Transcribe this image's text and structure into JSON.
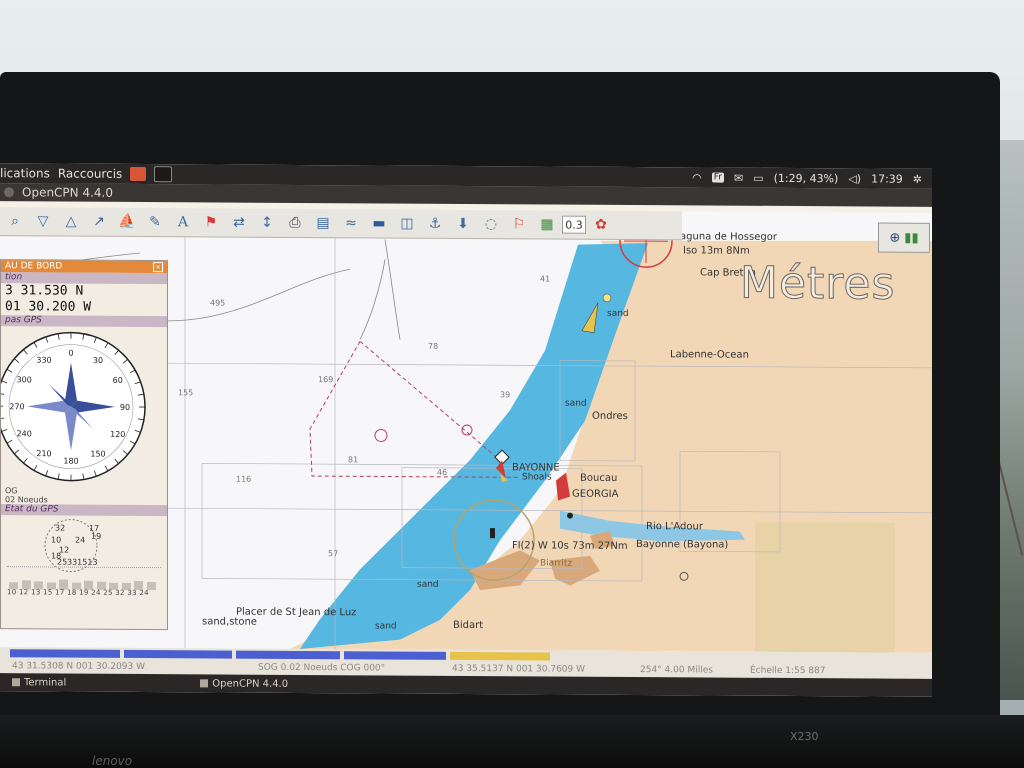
{
  "system_bar": {
    "menus": [
      "lications",
      "Raccourcis"
    ],
    "kbd_layout": "Fr",
    "battery": "(1:29, 43%)",
    "clock": "17:39"
  },
  "window": {
    "title": "OpenCPN 4.4.0"
  },
  "toolbar": {
    "scale_value": "0.3"
  },
  "overlay": {
    "units_watermark": "Métres"
  },
  "dashboard": {
    "title": "AU DE BORD",
    "section_position": "tion",
    "lat": "3 31.530 N",
    "lon": "01 30.200 W",
    "section_compass": "pas GPS",
    "compass_labels": [
      "0",
      "30",
      "60",
      "90",
      "120",
      "150",
      "180",
      "210",
      "240",
      "270",
      "300",
      "330"
    ],
    "sog_line1": "OG",
    "sog_line2": "02 Noeuds",
    "section_gps": "Etat du GPS",
    "sat_ids": [
      "32",
      "17",
      "10",
      "24",
      "19",
      "12",
      "18",
      "25",
      "331513"
    ],
    "sat_numbers": "10 12 13 15 17 18 19 24 25 32 33 24"
  },
  "chart": {
    "places": {
      "hossegor": "aguna de Hossegor",
      "hossegor_light": "Iso 13m 8Nm",
      "cap_breton": "Cap Breton",
      "labenne": "Labenne-Ocean",
      "ondres": "Ondres",
      "boucau": "Boucau",
      "bayonne_label": "BAYONNE",
      "shoals": "Shoals",
      "georgia": "GEORGIA",
      "rio_adour": "Rio L'Adour",
      "bayonne": "Bayonne (Bayona)",
      "biarritz": "Biarritz",
      "bidart": "Bidart",
      "placer": "Placer de St Jean de Luz",
      "sand_stone": "sand,stone",
      "light_label": "Fl(2) W 10s 73m 27Nm"
    },
    "sand_labels": [
      "sand",
      "sand",
      "sand",
      "sand"
    ],
    "depths": [
      "41",
      "495",
      "78",
      "169",
      "39",
      "155",
      "81",
      "46",
      "116",
      "57"
    ]
  },
  "status": {
    "own_pos": "43 31.5308 N  001 30.2093 W",
    "sog_cog": "SOG 0.02 Noeuds  COG 000°",
    "cursor_pos": "43 35.5137 N  001 30.7609 W",
    "range": "254°  4.00 Milles",
    "scale": "Échelle 1:55 887"
  },
  "taskbar": {
    "items": [
      "Terminal",
      "OpenCPN 4.4.0"
    ]
  },
  "hardware": {
    "brand": "lenovo",
    "model": "X230"
  },
  "colors": {
    "land": "#f2d7b6",
    "shallow_water": "#56b7e0",
    "deep_water": "#ffffff",
    "dashboard_header": "#e4893a",
    "progress_blue": "#4b5fd0",
    "progress_yellow": "#e8c34a"
  }
}
